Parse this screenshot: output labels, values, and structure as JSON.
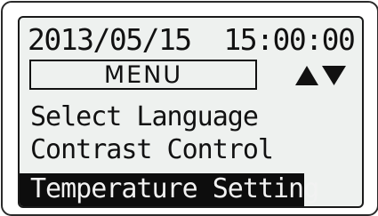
{
  "header": {
    "datetime": "2013/05/15  15:00:00"
  },
  "menu": {
    "title": "MENU",
    "nav_icons": [
      "up-arrow-icon",
      "down-arrow-icon"
    ],
    "items": [
      {
        "label": "Select Language",
        "selected": false
      },
      {
        "label": "Contrast Control",
        "selected": false
      },
      {
        "label": "Temperature Setting",
        "selected": true
      }
    ]
  },
  "colors": {
    "screen_background": "#eef1ef",
    "text": "#111111",
    "highlight_background": "#0d0d0d",
    "highlight_text": "#f2f2f2"
  }
}
